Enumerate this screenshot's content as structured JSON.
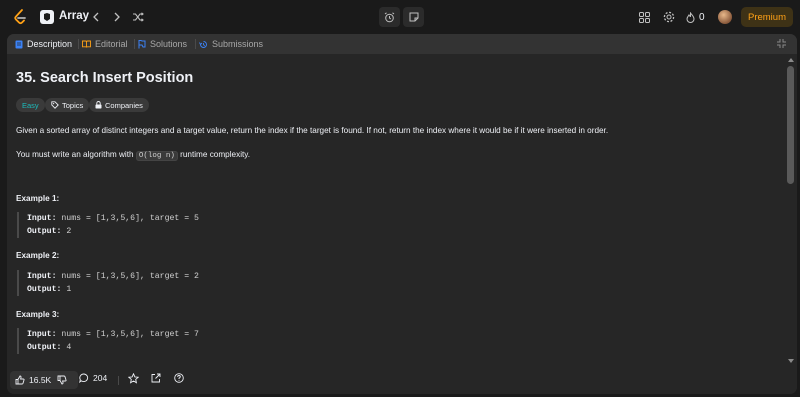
{
  "topbar": {
    "list_title": "Array",
    "streak_count": "0",
    "premium_label": "Premium"
  },
  "tabs": [
    {
      "label": "Description",
      "icon": "description-icon",
      "active": true,
      "color": "#3b82f6"
    },
    {
      "label": "Editorial",
      "icon": "editorial-icon",
      "active": false,
      "color": "#ffa116"
    },
    {
      "label": "Solutions",
      "icon": "solutions-icon",
      "active": false,
      "color": "#3b82f6"
    },
    {
      "label": "Submissions",
      "icon": "submissions-icon",
      "active": false,
      "color": "#3b82f6"
    }
  ],
  "problem": {
    "title": "35. Search Insert Position",
    "difficulty": "Easy",
    "topics_label": "Topics",
    "companies_label": "Companies",
    "description": "Given a sorted array of distinct integers and a target value, return the index if the target is found. If not, return the index where it would be if it were inserted in order.",
    "complexity_before": "You must write an algorithm with ",
    "complexity_code": "O(log n)",
    "complexity_after": " runtime complexity."
  },
  "examples": [
    {
      "title": "Example 1:",
      "input_label": "Input:",
      "input": " nums = [1,3,5,6], target = 5",
      "output_label": "Output:",
      "output": " 2"
    },
    {
      "title": "Example 2:",
      "input_label": "Input:",
      "input": " nums = [1,3,5,6], target = 2",
      "output_label": "Output:",
      "output": " 1"
    },
    {
      "title": "Example 3:",
      "input_label": "Input:",
      "input": " nums = [1,3,5,6], target = 7",
      "output_label": "Output:",
      "output": " 4"
    }
  ],
  "footer": {
    "likes": "16.5K",
    "comments": "204"
  },
  "colors": {
    "accent": "#ffa116",
    "easy": "#1cbaba",
    "background": "#1a1a1a",
    "panel": "#262626"
  }
}
